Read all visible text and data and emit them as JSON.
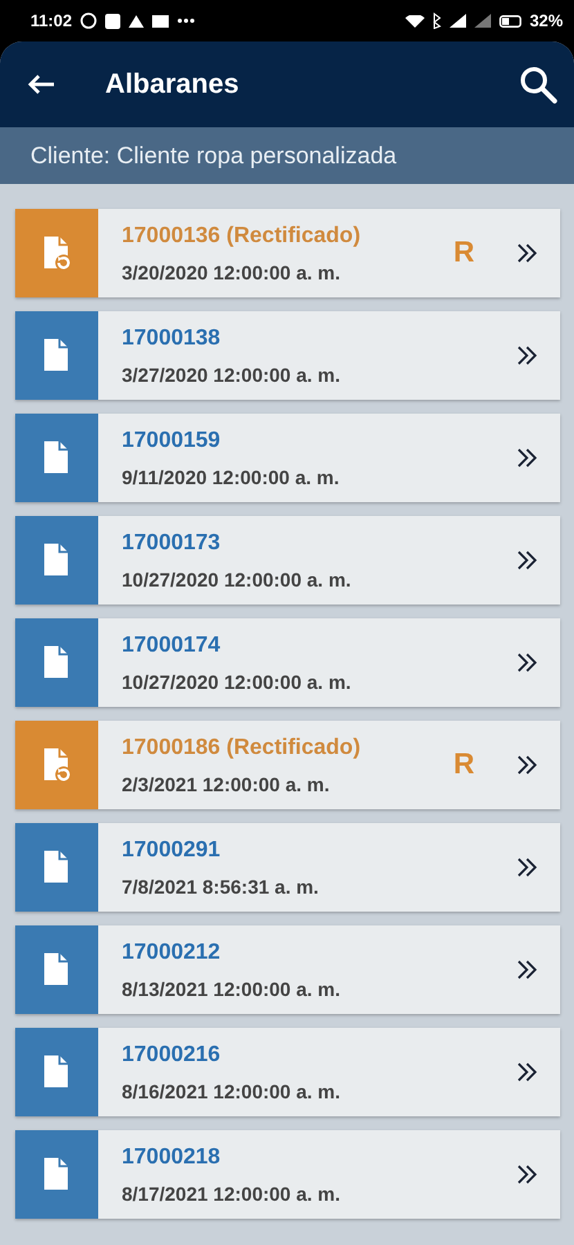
{
  "status_bar": {
    "time": "11:02",
    "battery": "32%"
  },
  "header": {
    "title": "Albaranes"
  },
  "subheader": {
    "text": "Cliente: Cliente ropa personalizada"
  },
  "rows": [
    {
      "kind": "rectified",
      "number": "17000136 (Rectificado)",
      "date": "3/20/2020 12:00:00 a. m.",
      "badge": "R"
    },
    {
      "kind": "normal",
      "number": "17000138",
      "date": "3/27/2020 12:00:00 a. m."
    },
    {
      "kind": "normal",
      "number": "17000159",
      "date": "9/11/2020 12:00:00 a. m."
    },
    {
      "kind": "normal",
      "number": "17000173",
      "date": "10/27/2020 12:00:00 a. m."
    },
    {
      "kind": "normal",
      "number": "17000174",
      "date": "10/27/2020 12:00:00 a. m."
    },
    {
      "kind": "rectified",
      "number": "17000186 (Rectificado)",
      "date": "2/3/2021 12:00:00 a. m.",
      "badge": "R"
    },
    {
      "kind": "normal",
      "number": "17000291",
      "date": "7/8/2021 8:56:31 a. m."
    },
    {
      "kind": "normal",
      "number": "17000212",
      "date": "8/13/2021 12:00:00 a. m."
    },
    {
      "kind": "normal",
      "number": "17000216",
      "date": "8/16/2021 12:00:00 a. m."
    },
    {
      "kind": "normal",
      "number": "17000218",
      "date": "8/17/2021 12:00:00 a. m."
    }
  ]
}
